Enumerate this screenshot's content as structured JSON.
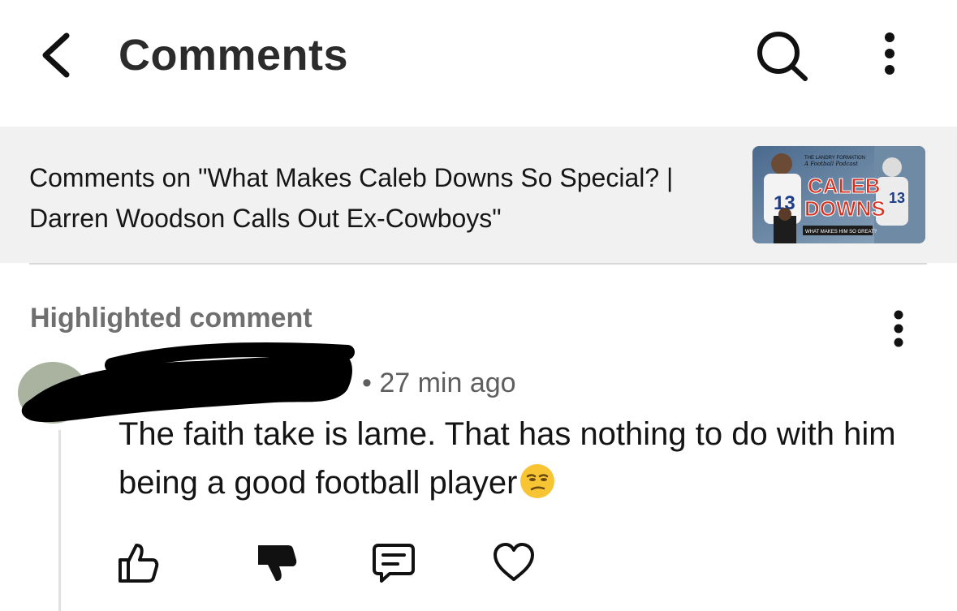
{
  "header": {
    "title": "Comments",
    "back_icon": "chevron-left-icon",
    "search_icon": "search-icon",
    "more_icon": "vertical-dots-icon"
  },
  "video": {
    "context_text": "Comments on \"What Makes Caleb Downs So Special? | Darren Woodson Calls Out Ex-Cowboys\"",
    "thumbnail": {
      "top_line": "THE LANDRY FORMATION",
      "script_line": "A Football Podcast",
      "name_line1": "CALEB",
      "name_line2": "DOWNS",
      "bottom_line": "WHAT MAKES HIM SO GREAT?",
      "accent_color": "#d9311f"
    }
  },
  "highlighted": {
    "label": "Highlighted comment",
    "comment": {
      "time": "• 27 min ago",
      "text": "The faith take is lame. That has nothing to do with him being a good football player",
      "emoji": "unamused-face-emoji"
    }
  },
  "actions": {
    "like_icon": "thumbs-up-icon",
    "dislike_icon": "thumbs-down-icon",
    "reply_icon": "comment-icon",
    "heart_icon": "heart-icon"
  }
}
